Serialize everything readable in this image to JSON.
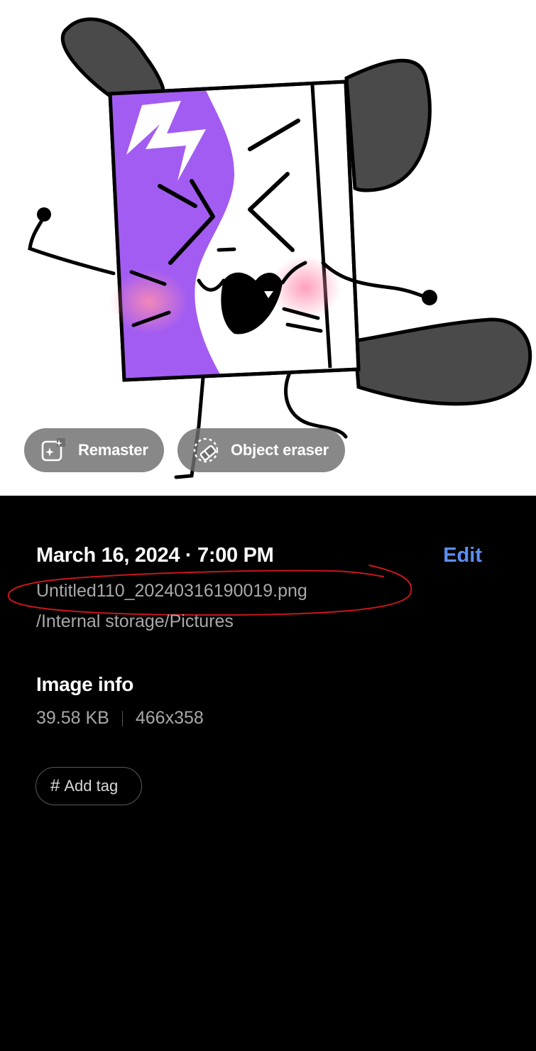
{
  "actions": {
    "remaster_label": "Remaster",
    "object_eraser_label": "Object eraser",
    "remaster_icon": "sparkle-edit-icon",
    "object_eraser_icon": "eraser-icon"
  },
  "details": {
    "date_time": "March 16, 2024 · 7:00 PM",
    "edit_label": "Edit",
    "file_name": "Untitled110_20240316190019.png",
    "file_path": "/Internal storage/Pictures"
  },
  "image_info": {
    "title": "Image info",
    "size": "39.58 KB",
    "resolution": "466x358"
  },
  "tag": {
    "icon": "#",
    "label": "Add tag"
  },
  "colors": {
    "edit_link": "#5b8ff5",
    "annotation_ink": "#c8161d",
    "purple": "#a35cf2"
  }
}
